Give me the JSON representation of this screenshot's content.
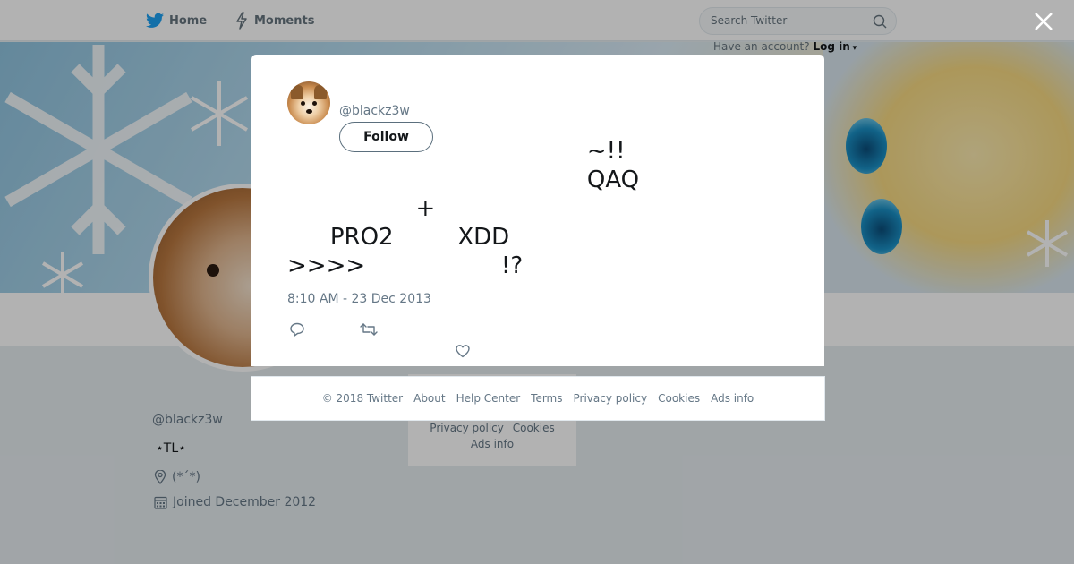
{
  "nav": {
    "home_label": "Home",
    "moments_label": "Moments",
    "search_placeholder": "Search Twitter",
    "have_account_text": "Have an account?",
    "login_label": "Log in"
  },
  "profile": {
    "name": "ㅤㅤ",
    "handle": "@blackz3w",
    "bio": "⋆TL⋆",
    "location": "(*´*)",
    "joined": "Joined December 2012"
  },
  "side_footer": {
    "privacy": "Privacy policy",
    "cookies": "Cookies",
    "ads": "Ads info"
  },
  "modal": {
    "handle": "@blackz3w",
    "follow_label": "Follow",
    "tweet_text": "ㅤㅤㅤㅤㅤㅤㅤㅤㅤㅤㅤㅤㅤㅤ~!!\nㅤㅤㅤㅤㅤㅤㅤㅤㅤㅤㅤㅤㅤㅤQAQ\nㅤㅤㅤㅤㅤㅤ+ㅤㅤㅤ\nㅤㅤPRO2ㅤㅤㅤXDD\n>>>>ㅤㅤㅤㅤㅤㅤ !?",
    "timestamp": "8:10 AM - 23 Dec 2013"
  },
  "footer": {
    "copyright": "© 2018 Twitter",
    "about": "About",
    "help": "Help Center",
    "terms": "Terms",
    "privacy": "Privacy policy",
    "cookies": "Cookies",
    "ads": "Ads info"
  },
  "colors": {
    "accent": "#1da1f2",
    "text_primary": "#14171a",
    "text_secondary": "#657786"
  },
  "icons": [
    "twitter-bird-icon",
    "lightning-icon",
    "search-icon",
    "close-icon",
    "location-icon",
    "calendar-icon",
    "reply-icon",
    "retweet-icon",
    "heart-icon"
  ]
}
